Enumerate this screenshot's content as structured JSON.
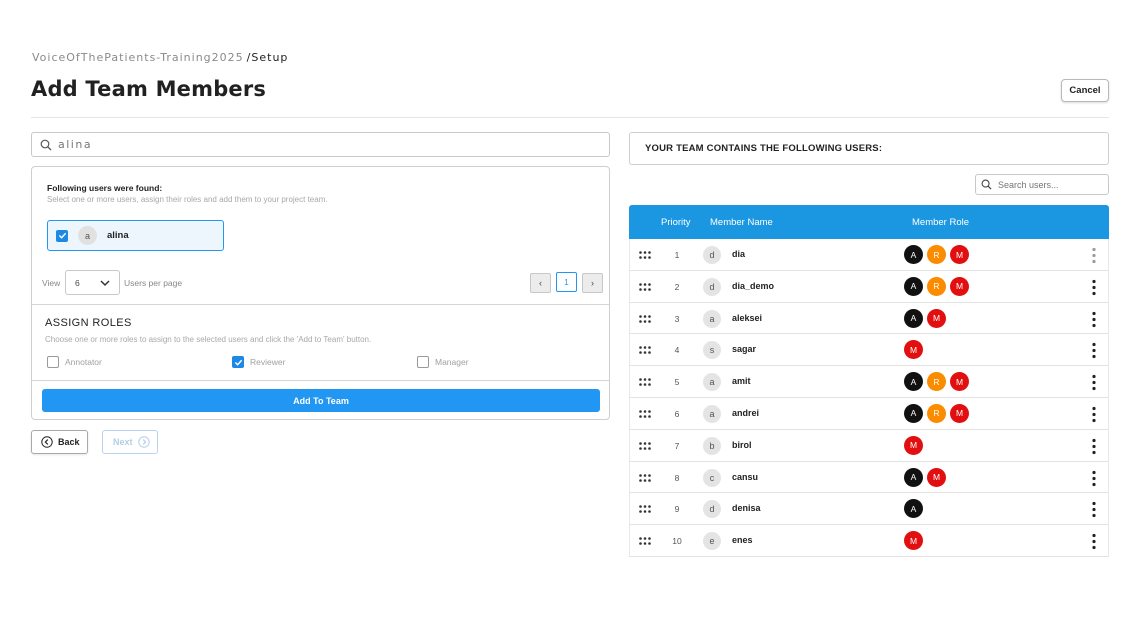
{
  "breadcrumb": {
    "project": "VoiceOfThePatients-Training2025",
    "separator": "/",
    "current": "Setup"
  },
  "page_title": "Add Team Members",
  "cancel_label": "Cancel",
  "search": {
    "value": "alina"
  },
  "results": {
    "title": "Following users were found:",
    "subtitle": "Select one or more users, assign their roles and add them to your project team.",
    "users": [
      {
        "initial": "a",
        "name": "alina",
        "selected": true
      }
    ]
  },
  "pagination": {
    "view_label": "View",
    "per_page": "6",
    "per_page_label": "Users per page",
    "prev": "‹",
    "current_page": "1",
    "next": "›"
  },
  "assign_roles": {
    "title": "ASSIGN ROLES",
    "subtitle": "Choose one or more roles to assign to the selected users and click the 'Add to Team' button.",
    "roles": [
      {
        "label": "Annotator",
        "checked": false
      },
      {
        "label": "Reviewer",
        "checked": true
      },
      {
        "label": "Manager",
        "checked": false
      }
    ],
    "add_button": "Add To Team"
  },
  "nav": {
    "back": "Back",
    "next": "Next"
  },
  "team": {
    "header": "YOUR TEAM CONTAINS THE FOLLOWING USERS:",
    "search_placeholder": "Search users...",
    "columns": {
      "priority": "Priority",
      "name": "Member Name",
      "role": "Member Role"
    },
    "role_colors": {
      "A": "#111111",
      "R": "#fb8c00",
      "M": "#e10f0f"
    },
    "members": [
      {
        "priority": "1",
        "initial": "d",
        "name": "dia",
        "roles": [
          "A",
          "R",
          "M"
        ]
      },
      {
        "priority": "2",
        "initial": "d",
        "name": "dia_demo",
        "roles": [
          "A",
          "R",
          "M"
        ]
      },
      {
        "priority": "3",
        "initial": "a",
        "name": "aleksei",
        "roles": [
          "A",
          "M"
        ]
      },
      {
        "priority": "4",
        "initial": "s",
        "name": "sagar",
        "roles": [
          "M"
        ]
      },
      {
        "priority": "5",
        "initial": "a",
        "name": "amit",
        "roles": [
          "A",
          "R",
          "M"
        ]
      },
      {
        "priority": "6",
        "initial": "a",
        "name": "andrei",
        "roles": [
          "A",
          "R",
          "M"
        ]
      },
      {
        "priority": "7",
        "initial": "b",
        "name": "birol",
        "roles": [
          "M"
        ]
      },
      {
        "priority": "8",
        "initial": "c",
        "name": "cansu",
        "roles": [
          "A",
          "M"
        ]
      },
      {
        "priority": "9",
        "initial": "d",
        "name": "denisa",
        "roles": [
          "A"
        ]
      },
      {
        "priority": "10",
        "initial": "e",
        "name": "enes",
        "roles": [
          "M"
        ]
      }
    ]
  }
}
